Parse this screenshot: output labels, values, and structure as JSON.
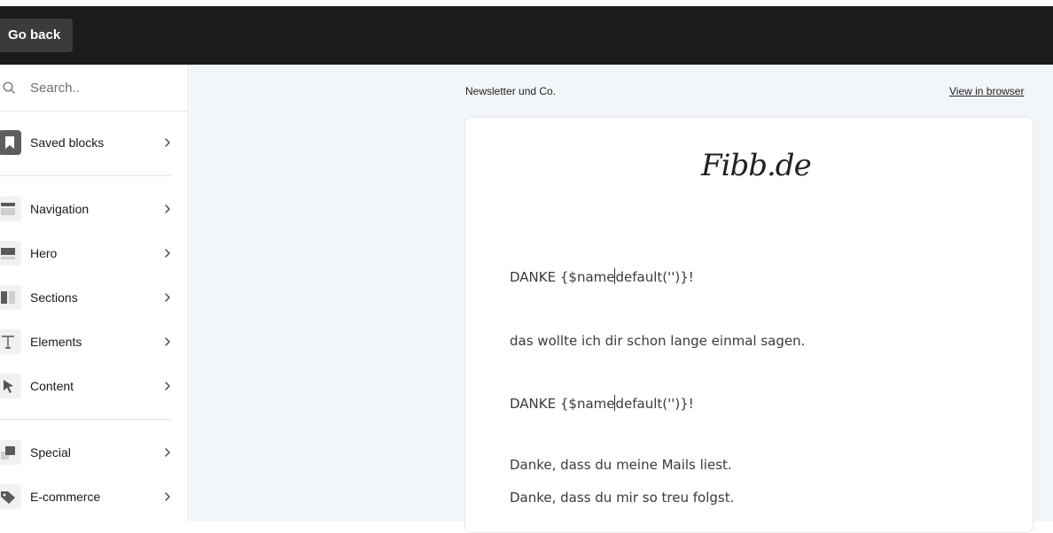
{
  "topbar": {
    "go_back_label": "Go back"
  },
  "sidebar": {
    "search_placeholder": "Search..",
    "items": [
      {
        "label": "Saved blocks",
        "icon": "bookmark-icon"
      },
      {
        "label": "Navigation",
        "icon": "navigation-layout-icon"
      },
      {
        "label": "Hero",
        "icon": "hero-layout-icon"
      },
      {
        "label": "Sections",
        "icon": "sections-layout-icon"
      },
      {
        "label": "Elements",
        "icon": "text-t-icon"
      },
      {
        "label": "Content",
        "icon": "cursor-pointer-icon"
      },
      {
        "label": "Special",
        "icon": "special-blocks-icon"
      },
      {
        "label": "E-commerce",
        "icon": "tag-icon"
      }
    ]
  },
  "email": {
    "preheader": "Newsletter und Co.",
    "view_in_browser": "View in browser",
    "logo_text": "Fibb.de",
    "lines": [
      {
        "before": "DANKE {$name",
        "after": "default('')}!"
      },
      {
        "text": "das wollte ich dir schon lange einmal sagen."
      },
      {
        "before": "DANKE {$name",
        "after": "default('')}!"
      },
      {
        "text": "Danke, dass du meine Mails liest."
      },
      {
        "text": "Danke, dass du mir so treu folgst."
      }
    ]
  },
  "colors": {
    "topbar": "#1b1b1b",
    "go_back_button": "#3b3b3b",
    "canvas_bg": "#f3f6f9",
    "icon_fill": "#555555"
  }
}
